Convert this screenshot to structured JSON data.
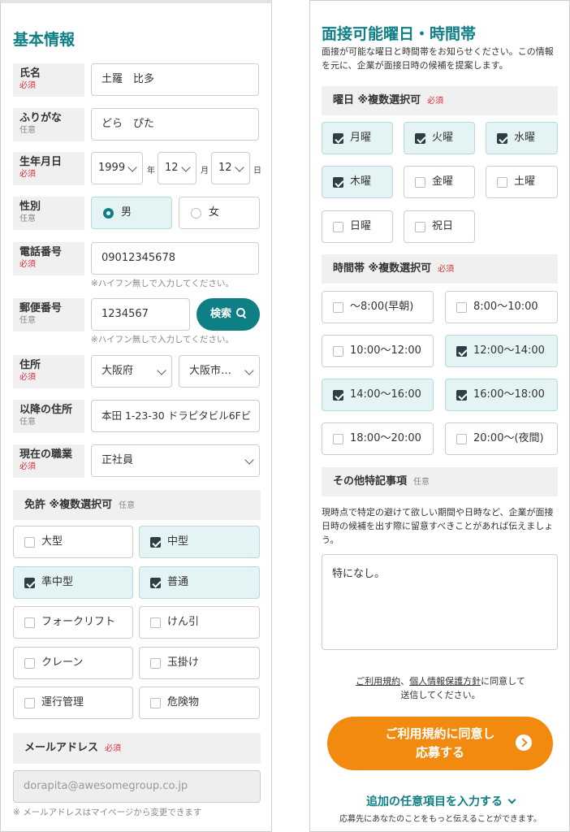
{
  "basic": {
    "title": "基本情報",
    "required": "必須",
    "optional": "任意",
    "name": {
      "label": "氏名",
      "value": "土羅　比多"
    },
    "furigana": {
      "label": "ふりがな",
      "value": "どら　ぴた"
    },
    "birthday": {
      "label": "生年月日",
      "year": "1999",
      "year_unit": "年",
      "month": "12",
      "month_unit": "月",
      "day": "12",
      "day_unit": "日"
    },
    "gender": {
      "label": "性別",
      "male": "男",
      "female": "女",
      "selected": "男"
    },
    "phone": {
      "label": "電話番号",
      "value": "09012345678",
      "hint": "※ハイフン無しで入力してください。"
    },
    "postal": {
      "label": "郵便番号",
      "value": "1234567",
      "search": "検索",
      "hint": "※ハイフン無しで入力してください。"
    },
    "address": {
      "label": "住所",
      "prefecture": "大阪府",
      "city": "大阪市…"
    },
    "address2": {
      "label": "以降の住所",
      "value": "本田 1-23-30 ドラピタビル6Fビ"
    },
    "occupation": {
      "label": "現在の職業",
      "value": "正社員"
    },
    "license": {
      "label": "免許 ※複数選択可",
      "items": [
        {
          "label": "大型",
          "checked": false
        },
        {
          "label": "中型",
          "checked": true
        },
        {
          "label": "準中型",
          "checked": true
        },
        {
          "label": "普通",
          "checked": true
        },
        {
          "label": "フォークリフト",
          "checked": false
        },
        {
          "label": "けん引",
          "checked": false
        },
        {
          "label": "クレーン",
          "checked": false
        },
        {
          "label": "玉掛け",
          "checked": false
        },
        {
          "label": "運行管理",
          "checked": false
        },
        {
          "label": "危険物",
          "checked": false
        }
      ]
    },
    "email": {
      "label": "メールアドレス",
      "value": "dorapita@awesomegroup.co.jp",
      "note": "※ メールアドレスはマイページから変更できます"
    }
  },
  "interview": {
    "title": "面接可能曜日・時間帯",
    "description": "面接が可能な曜日と時間帯をお知らせください。この情報を元に、企業が面接日時の候補を提案します。",
    "days_label": "曜日 ※複数選択可",
    "required": "必須",
    "optional": "任意",
    "days": [
      {
        "label": "月曜",
        "checked": true
      },
      {
        "label": "火曜",
        "checked": true
      },
      {
        "label": "水曜",
        "checked": true
      },
      {
        "label": "木曜",
        "checked": true
      },
      {
        "label": "金曜",
        "checked": false
      },
      {
        "label": "土曜",
        "checked": false
      },
      {
        "label": "日曜",
        "checked": false
      },
      {
        "label": "祝日",
        "checked": false
      }
    ],
    "times_label": "時間帯 ※複数選択可",
    "times": [
      {
        "label": "〜8:00(早朝)",
        "checked": false
      },
      {
        "label": "8:00〜10:00",
        "checked": false
      },
      {
        "label": "10:00〜12:00",
        "checked": false
      },
      {
        "label": "12:00〜14:00",
        "checked": true
      },
      {
        "label": "14:00〜16:00",
        "checked": true
      },
      {
        "label": "16:00〜18:00",
        "checked": true
      },
      {
        "label": "18:00〜20:00",
        "checked": false
      },
      {
        "label": "20:00〜(夜間)",
        "checked": false
      }
    ],
    "notes_label": "その他特記事項",
    "notes_description": "現時点で特定の避けて欲しい期間や日時など、企業が面接日時の候補を出す際に留意すべきことがあれば伝えましょう。",
    "notes_value": "特になし。"
  },
  "submit": {
    "terms_link": "ご利用規約",
    "sep": "、",
    "privacy_link": "個人情報保護方針",
    "agree_suffix": "に同意して",
    "agree_line2": "送信してください。",
    "apply_line1": "ご利用規約に同意し",
    "apply_line2": "応募する",
    "more_link": "追加の任意項目を入力する",
    "more_caption": "応募先にあなたのことをもっと伝えることができます。"
  },
  "colors": {
    "accent": "#0e7f84",
    "apply": "#f28a0f",
    "required": "#d6303a",
    "checked_bg": "#e4f3f3"
  }
}
